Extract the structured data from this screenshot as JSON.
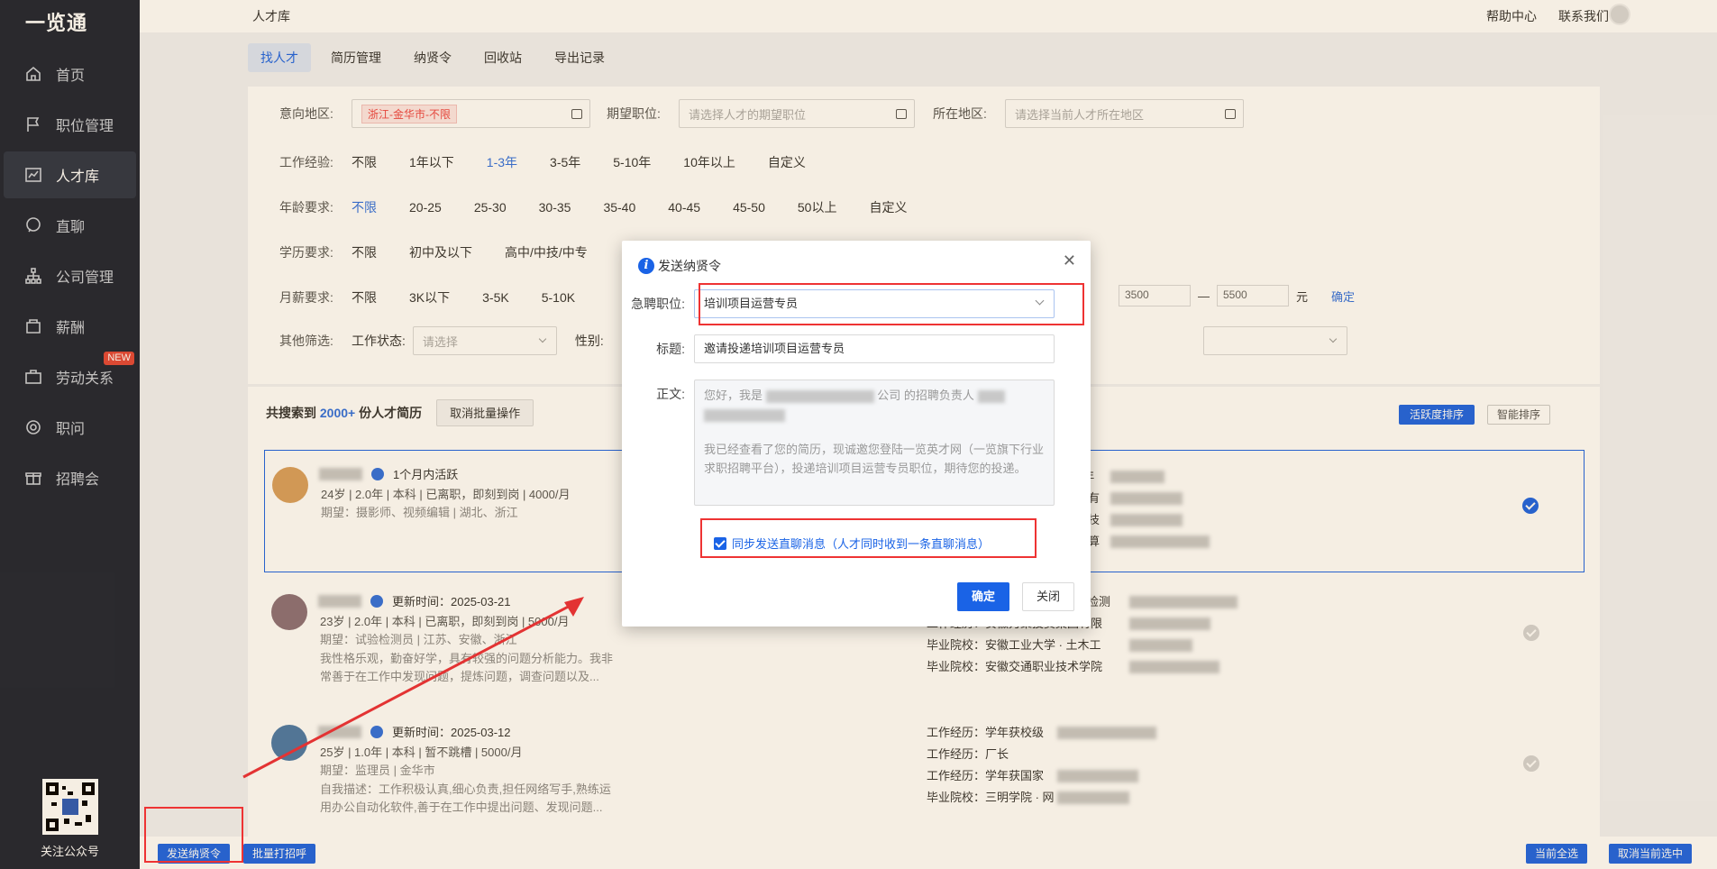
{
  "sidebar": {
    "logo": "一览通",
    "items": [
      {
        "label": "首页",
        "icon": "home-icon"
      },
      {
        "label": "职位管理",
        "icon": "flag-icon"
      },
      {
        "label": "人才库",
        "icon": "chart-icon",
        "active": true
      },
      {
        "label": "直聊",
        "icon": "chat-icon"
      },
      {
        "label": "公司管理",
        "icon": "org-icon"
      },
      {
        "label": "薪酬",
        "icon": "salary-icon"
      },
      {
        "label": "劳动关系",
        "icon": "briefcase-icon",
        "badge": "NEW"
      },
      {
        "label": "职问",
        "icon": "target-icon"
      },
      {
        "label": "招聘会",
        "icon": "gift-icon"
      }
    ],
    "qr_label": "关注公众号"
  },
  "topbar": {
    "title": "人才库",
    "help": "帮助中心",
    "contact": "联系我们"
  },
  "tabs": [
    "找人才",
    "简历管理",
    "纳贤令",
    "回收站",
    "导出记录"
  ],
  "filters": {
    "region_label": "意向地区:",
    "region_tag": "浙江-金华市-不限",
    "position_label": "期望职位:",
    "position_placeholder": "请选择人才的期望职位",
    "location_label": "所在地区:",
    "location_placeholder": "请选择当前人才所在地区",
    "experience_label": "工作经验:",
    "experience": [
      "不限",
      "1年以下",
      "1-3年",
      "3-5年",
      "5-10年",
      "10年以上",
      "自定义"
    ],
    "age_label": "年龄要求:",
    "age": [
      "不限",
      "20-25",
      "25-30",
      "30-35",
      "35-40",
      "40-45",
      "45-50",
      "50以上",
      "自定义"
    ],
    "edu_label": "学历要求:",
    "edu": [
      "不限",
      "初中及以下",
      "高中/中技/中专"
    ],
    "salary_label": "月薪要求:",
    "salary": [
      "不限",
      "3K以下",
      "3-5K",
      "5-10K"
    ],
    "salary_min": "3500",
    "salary_dash": "—",
    "salary_max": "5500",
    "salary_unit": "元",
    "salary_confirm": "确定",
    "other_label": "其他筛选:",
    "status_label": "工作状态:",
    "status_placeholder": "请选择",
    "gender_label": "性别:"
  },
  "results": {
    "count_prefix": "共搜索到",
    "count": "2000+",
    "count_suffix": "份人才简历",
    "cancel_batch": "取消批量操作",
    "sort_active": "活跃度排序",
    "sort_smart": "智能排序",
    "cards": [
      {
        "time": "1个月内活跃",
        "info": "24岁 | 2.0年 | 本科 | 已离职，即刻到岗 | 4000/月",
        "expect": "期望：摄影师、视频编辑 | 湖北、浙江",
        "right": [
          "0年",
          "技有",
          "科技",
          "计算"
        ],
        "selected": true
      },
      {
        "time": "更新时间：2025-03-21",
        "info": "23岁 | 2.0年 | 本科 | 已离职，即刻到岗 | 5000/月",
        "expect": "期望：试验检测员 | 江苏、安徽、浙江",
        "desc": "我性格乐观，勤奋好学，具有较强的问题分析能力。我非常善于在工作中发现问题，提炼问题，调查问题以及...",
        "right": [
          "验检测",
          "工作经历：安徽力聚投资集团有限",
          "毕业院校：安徽工业大学 · 土木工",
          "毕业院校：安徽交通职业技术学院"
        ],
        "selected": false
      },
      {
        "time": "更新时间：2025-03-12",
        "info": "25岁 | 1.0年 | 本科 | 暂不跳槽 | 5000/月",
        "expect": "期望：监理员 | 金华市",
        "desc": "自我描述：工作积极认真,细心负责,担任网络写手,熟练运用办公自动化软件,善于在工作中提出问题、发现问题...",
        "right": [
          "工作经历：学年获校级",
          "工作经历：厂长",
          "工作经历：学年获国家",
          "毕业院校：三明学院 · 网"
        ],
        "selected": false
      }
    ]
  },
  "bottom": {
    "send": "发送纳贤令",
    "call": "批量打招呼",
    "select_page": "当前全选",
    "cancel_page": "取消当前选中"
  },
  "modal": {
    "title": "发送纳贤令",
    "position_label": "急聘职位:",
    "position_value": "培训项目运营专员",
    "subject_label": "标题:",
    "subject_value": "邀请投递培训项目运营专员",
    "body_label": "正文:",
    "body_line1": "您好，我是",
    "body_line1b": "公司 的招聘负责人",
    "body_para2": "我已经查看了您的简历，现诚邀您登陆一览英才网（一览旗下行业求职招聘平台），投递培训项目运营专员职位，期待您的投递。",
    "sync_label": "同步发送直聊消息（人才同时收到一条直聊消息）",
    "ok": "确定",
    "close": "关闭"
  },
  "colors": {
    "accent": "#1a63e6",
    "sidebar": "#1d2333",
    "highlight": "#e33333"
  }
}
